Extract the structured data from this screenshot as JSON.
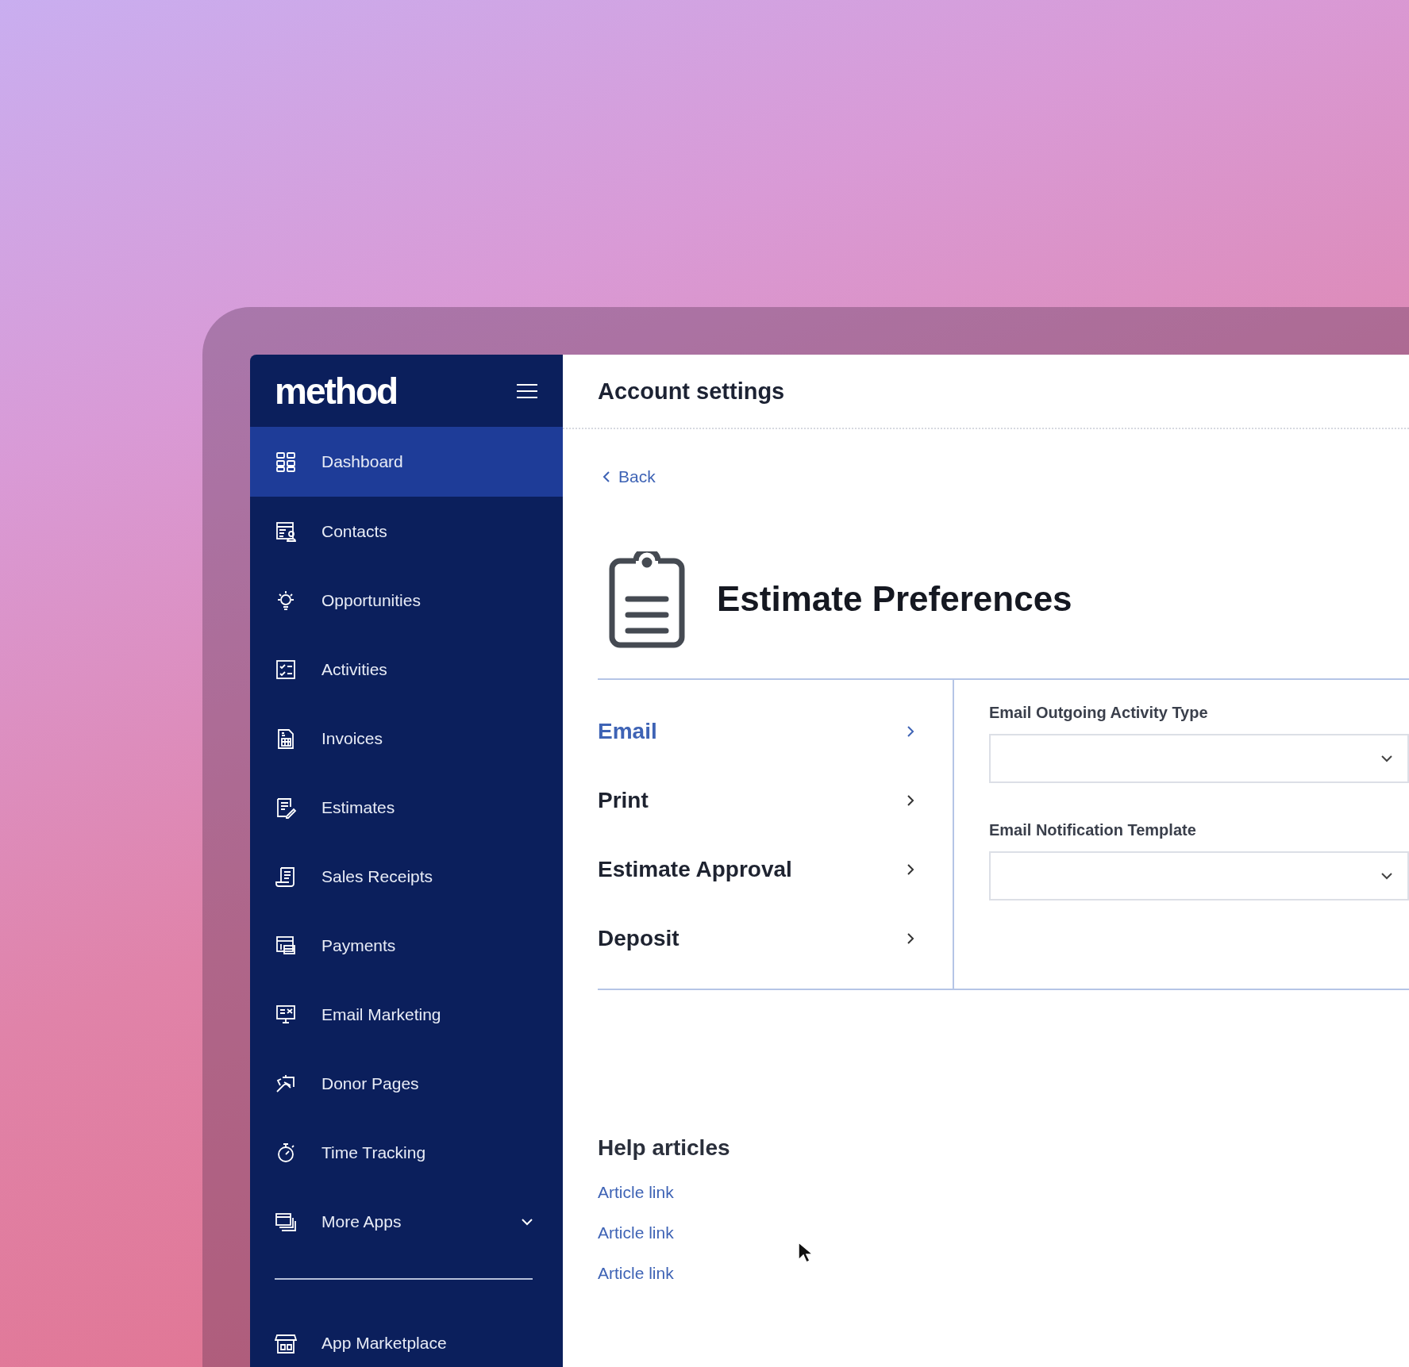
{
  "sidebar": {
    "logo": "method",
    "items": [
      {
        "label": "Dashboard",
        "selected": true,
        "kind": "link"
      },
      {
        "label": "Contacts",
        "selected": false,
        "kind": "link"
      },
      {
        "label": "Opportunities",
        "selected": false,
        "kind": "link"
      },
      {
        "label": "Activities",
        "selected": false,
        "kind": "link"
      },
      {
        "label": "Invoices",
        "selected": false,
        "kind": "link"
      },
      {
        "label": "Estimates",
        "selected": false,
        "kind": "link"
      },
      {
        "label": "Sales Receipts",
        "selected": false,
        "kind": "link"
      },
      {
        "label": "Payments",
        "selected": false,
        "kind": "link"
      },
      {
        "label": "Email Marketing",
        "selected": false,
        "kind": "link"
      },
      {
        "label": "Donor Pages",
        "selected": false,
        "kind": "link"
      },
      {
        "label": "Time Tracking",
        "selected": false,
        "kind": "link"
      },
      {
        "label": "More Apps",
        "selected": false,
        "kind": "group"
      }
    ],
    "footer_items": [
      {
        "label": "App Marketplace",
        "selected": false
      }
    ]
  },
  "header": {
    "title": "Account settings"
  },
  "back_link": "Back",
  "page_title": "Estimate Preferences",
  "sections": [
    {
      "label": "Email",
      "selected": true
    },
    {
      "label": "Print",
      "selected": false
    },
    {
      "label": "Estimate Approval",
      "selected": false
    },
    {
      "label": "Deposit",
      "selected": false
    }
  ],
  "fields": [
    {
      "label": "Email Outgoing Activity Type",
      "kind": "select"
    },
    {
      "label": "Email Notification Template",
      "kind": "select"
    }
  ],
  "help": {
    "title": "Help articles",
    "links": [
      "Article link",
      "Article link",
      "Article link"
    ]
  }
}
